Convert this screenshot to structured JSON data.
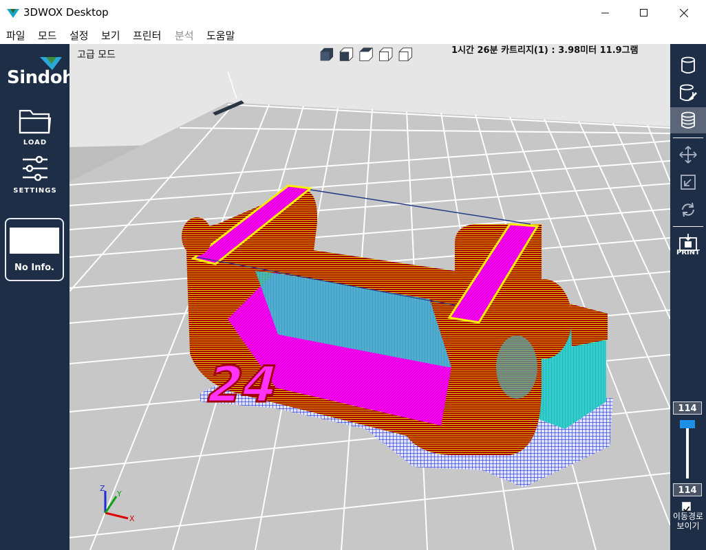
{
  "window": {
    "title": "3DWOX Desktop",
    "minimize_icon": "minimize-icon",
    "maximize_icon": "maximize-icon",
    "close_icon": "close-icon"
  },
  "menu": {
    "items": [
      {
        "label": "파일",
        "enabled": true
      },
      {
        "label": "모드",
        "enabled": true
      },
      {
        "label": "설정",
        "enabled": true
      },
      {
        "label": "보기",
        "enabled": true
      },
      {
        "label": "프린터",
        "enabled": true
      },
      {
        "label": "분석",
        "enabled": false
      },
      {
        "label": "도움말",
        "enabled": true
      }
    ]
  },
  "sidebar": {
    "brand": "Sindoh",
    "load_label": "LOAD",
    "settings_label": "SETTINGS",
    "info_text": "No Info."
  },
  "viewport": {
    "mode_label": "고급 모드",
    "print_stats": "1시간 26분  카트리지(1) : 3.98미터 11.9그램",
    "model_text": "24",
    "axis_labels": {
      "x": "X",
      "y": "Y",
      "z": "Z"
    },
    "view_cube_icons": [
      "cube-solid-icon",
      "cube-front-icon",
      "cube-top-icon",
      "cube-left-icon",
      "cube-right-icon"
    ]
  },
  "toolbar_right": {
    "print_label": "PRINT",
    "layer_top": "114",
    "layer_bottom": "114",
    "slider_fraction": 1.0,
    "show_path_label": "이동경로 보이기",
    "show_path_checked": true,
    "icons": [
      "cylinder-icon",
      "cylinder-edit-icon",
      "layers-icon",
      "move-icon",
      "scale-icon",
      "rotate-icon",
      "print-icon"
    ]
  },
  "colors": {
    "panel": "#1f2e47",
    "wall": "#a30000",
    "infill": "#ff00ff",
    "support": "#33cccc",
    "raft": "#1b2bd9",
    "highlight": "#ffee00"
  }
}
